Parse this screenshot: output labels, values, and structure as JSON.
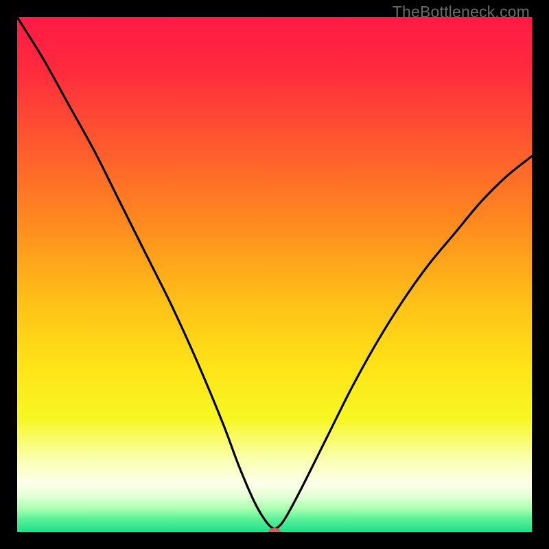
{
  "watermark": "TheBottleneck.com",
  "chart_data": {
    "type": "line",
    "title": "",
    "xlabel": "",
    "ylabel": "",
    "xlim": [
      0,
      100
    ],
    "ylim": [
      0,
      100
    ],
    "grid": false,
    "legend": false,
    "series": [
      {
        "name": "bottleneck-curve",
        "x": [
          0,
          5,
          10,
          15,
          20,
          25,
          30,
          35,
          40,
          43,
          46,
          48,
          49.5,
          50.5,
          52,
          55,
          60,
          65,
          70,
          75,
          80,
          85,
          90,
          95,
          100
        ],
        "y": [
          100,
          92,
          83,
          74,
          64,
          54,
          44,
          33,
          21,
          13,
          6,
          2.5,
          0.8,
          0.8,
          2.5,
          8,
          18,
          28,
          37,
          45,
          52,
          58,
          64,
          69,
          73
        ]
      }
    ],
    "marker": {
      "x": 50,
      "y": 0,
      "color": "#c06868",
      "rx": 9,
      "ry": 6
    },
    "gradient_stops": [
      {
        "offset": 0,
        "color": "#ff1a45"
      },
      {
        "offset": 0.1,
        "color": "#ff2a3e"
      },
      {
        "offset": 0.25,
        "color": "#ff5a2e"
      },
      {
        "offset": 0.4,
        "color": "#ff8a1f"
      },
      {
        "offset": 0.55,
        "color": "#ffbf18"
      },
      {
        "offset": 0.68,
        "color": "#ffe418"
      },
      {
        "offset": 0.78,
        "color": "#f7f723"
      },
      {
        "offset": 0.86,
        "color": "#faffb0"
      },
      {
        "offset": 0.905,
        "color": "#fdffe8"
      },
      {
        "offset": 0.93,
        "color": "#e6ffd8"
      },
      {
        "offset": 0.955,
        "color": "#a9ffb0"
      },
      {
        "offset": 0.975,
        "color": "#5cf098"
      },
      {
        "offset": 1.0,
        "color": "#1fe08a"
      }
    ]
  }
}
